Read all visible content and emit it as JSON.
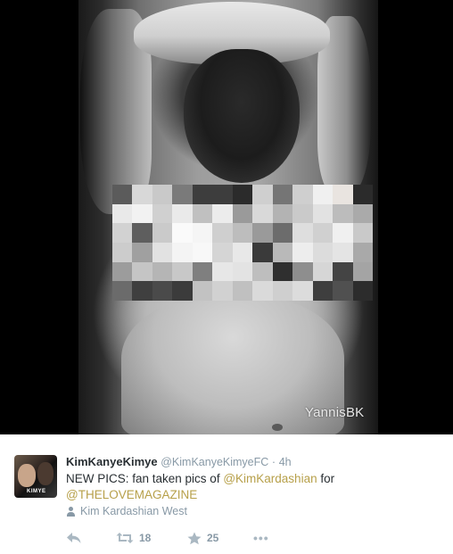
{
  "media": {
    "watermark": "YannisBK",
    "mosaic_colors": [
      [
        "#5b5b5b",
        "#d8d8d8",
        "#c9c9c9",
        "#7a7a7a",
        "#3d3d3d",
        "#3d3d3d",
        "#2b2b2b",
        "#cfcfcf",
        "#757575",
        "#cfcfcf",
        "#f0f0f0",
        "#e9e4e0",
        "#2b2b2b"
      ],
      [
        "#e9e9e9",
        "#f2f2f2",
        "#d0d0d0",
        "#eaeaea",
        "#c0c0c0",
        "#ececec",
        "#9a9a9a",
        "#d9d9d9",
        "#b3b3b3",
        "#cacaca",
        "#e2e2e2",
        "#bcbcbc",
        "#aaaaaa"
      ],
      [
        "#d2d2d2",
        "#5e5e5e",
        "#cacaca",
        "#fafafa",
        "#f5f5f5",
        "#cfcfcf",
        "#bdbdbd",
        "#9a9a9a",
        "#6c6c6c",
        "#dedede",
        "#d0d0d0",
        "#f0f0f0",
        "#c9c9c9"
      ],
      [
        "#cccccc",
        "#a0a0a0",
        "#e2e2e2",
        "#f4f4f4",
        "#f8f8f8",
        "#d5d5d5",
        "#e8e8e8",
        "#3a3a3a",
        "#b9b9b9",
        "#ededed",
        "#dcdcdc",
        "#e4e4e4",
        "#a9a9a9"
      ],
      [
        "#9c9c9c",
        "#c5c5c5",
        "#b5b5b5",
        "#c8c8c8",
        "#7f7f7f",
        "#e7e7e7",
        "#e3e3e3",
        "#bebebe",
        "#2f2f2f",
        "#8e8e8e",
        "#d6d6d6",
        "#444444",
        "#a4a4a4"
      ],
      [
        "#6b6b6b",
        "#3f3f3f",
        "#4a4a4a",
        "#3b3b3b",
        "#c2c2c2",
        "#d1d1d1",
        "#c0c0c0",
        "#dadada",
        "#cfcfcf",
        "#dcdcdc",
        "#3e3e3e",
        "#505050",
        "#2c2c2c"
      ]
    ]
  },
  "tweet": {
    "avatar_tag": "KIMYE",
    "display_name": "KimKanyeKimye",
    "handle": "@KimKanyeKimyeFC",
    "separator": "·",
    "time": "4h",
    "text_prefix": "NEW PICS: fan taken pics of ",
    "mention_1": "@KimKardashian",
    "text_middle": " for",
    "mention_2": "@THELOVEMAGAZINE",
    "context_label": "Kim Kardashian West",
    "retweet_count": "18",
    "favorite_count": "25",
    "more_label": "•••"
  },
  "colors": {
    "mention": "#b7a04a",
    "muted": "#8899a6",
    "text": "#292f33"
  },
  "icons": [
    "reply-icon",
    "retweet-icon",
    "favorite-star-icon",
    "more-icon",
    "person-icon"
  ]
}
